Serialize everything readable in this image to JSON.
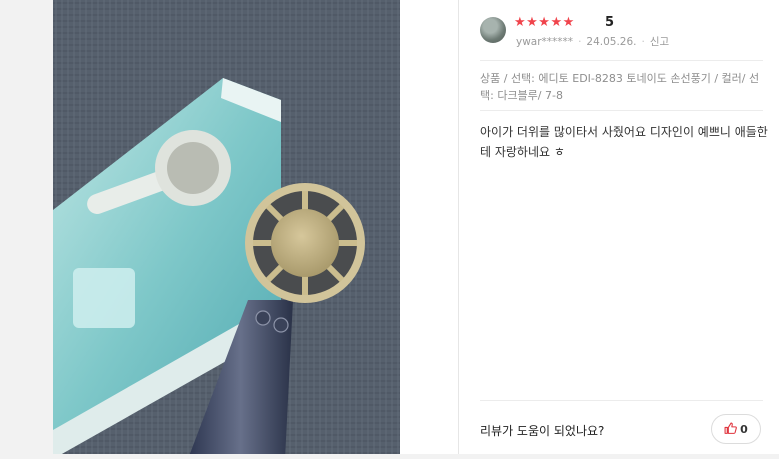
{
  "photo": {
    "alt": "Review photo of handheld fan"
  },
  "review": {
    "stars": "★★★★★",
    "rating": "5",
    "author": "ywar******",
    "date": "24.05.26.",
    "report_label": "신고",
    "product_info": "상품 / 선택: 에디토 EDI-8283 토네이도 손선풍기 / 컬러/ 선택: 다크블루/ 7-8",
    "body": "아이가 더위를 많이타서 사줬어요 디자인이 예쁘니 애들한테 자랑하네요 ㅎ",
    "helpful_question": "리뷰가 도움이 되었나요?",
    "like_count": "0"
  },
  "colors": {
    "star": "#f0444c",
    "like_icon": "#e0353f"
  },
  "icons": {
    "avatar": "avatar",
    "like": "thumbs-up-icon"
  }
}
